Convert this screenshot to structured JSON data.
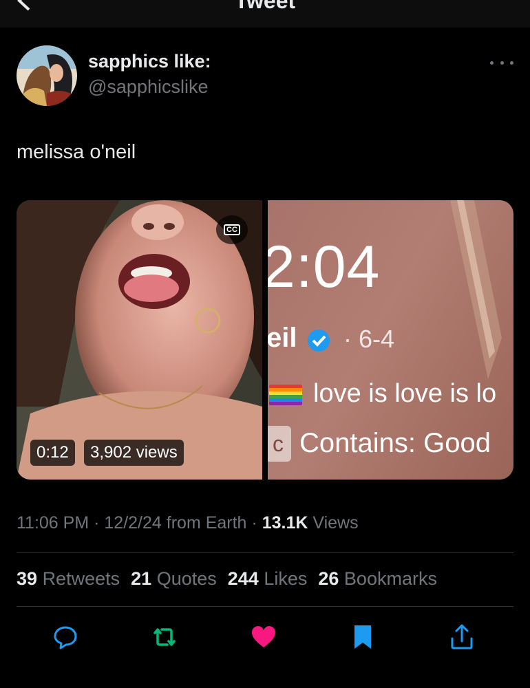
{
  "header": {
    "title": "Tweet"
  },
  "author": {
    "display_name": "sapphics like:",
    "handle": "@sapphicslike"
  },
  "tweet": {
    "text": "melissa o'neil"
  },
  "media": {
    "left_video": {
      "duration": "0:12",
      "views": "3,902 views",
      "captions_label": "CC"
    },
    "right_image": {
      "time": "2:04",
      "name_fragment": "eil",
      "date": "· 6-4",
      "bio": "love is love is lo",
      "warning_box": "c",
      "warning": "Contains: Good"
    }
  },
  "meta": {
    "time": "11:06 PM",
    "sep1": "·",
    "date": "12/2/24",
    "source": "from Earth",
    "sep2": "·",
    "views_count": "13.1K",
    "views_label": "Views"
  },
  "stats": [
    {
      "count": "39",
      "label": "Retweets"
    },
    {
      "count": "21",
      "label": "Quotes"
    },
    {
      "count": "244",
      "label": "Likes"
    },
    {
      "count": "26",
      "label": "Bookmarks"
    }
  ],
  "colors": {
    "background": "#000000",
    "text_primary": "#e7e9ea",
    "text_secondary": "#71767b",
    "divider": "#2f3336",
    "retweet_green": "#00ba7c",
    "like_pink": "#f91880",
    "bookmark_blue": "#1d9bf0"
  },
  "icons": [
    "back-arrow-icon",
    "more-options-icon",
    "captions-icon",
    "verified-badge-icon",
    "rainbow-flag-icon",
    "reply-icon",
    "retweet-icon",
    "like-icon",
    "bookmark-icon",
    "share-icon"
  ]
}
